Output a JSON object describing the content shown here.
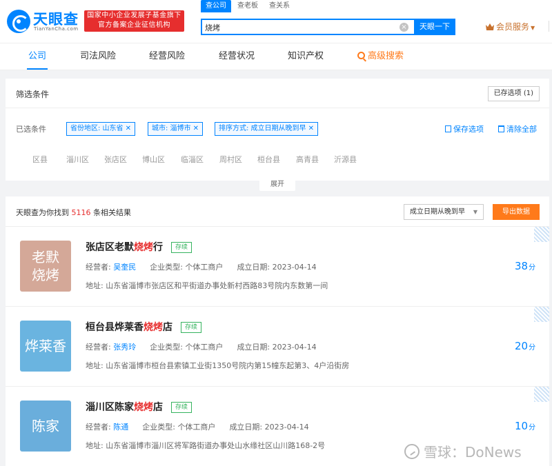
{
  "header": {
    "logo_text": "天眼查",
    "logo_sub": "TianYanCha.com",
    "badge_line1": "国家中小企业发展子基金旗下",
    "badge_line2": "官方备案企业征信机构",
    "search_tabs": [
      "查公司",
      "查老板",
      "查关系"
    ],
    "search_value": "烧烤",
    "search_button": "天眼一下",
    "member": "会员服务"
  },
  "nav": {
    "items": [
      "公司",
      "司法风险",
      "经营风险",
      "经营状况",
      "知识产权"
    ],
    "advanced": "高级搜索"
  },
  "filter": {
    "title": "筛选条件",
    "saved_button": "已存选项 (1)",
    "selected_label": "已选条件",
    "chips": [
      "省份地区: 山东省",
      "城市: 淄博市",
      "排序方式: 成立日期从晚到早"
    ],
    "save_link": "保存选项",
    "clear_link": "清除全部",
    "districts": [
      "区县",
      "淄川区",
      "张店区",
      "博山区",
      "临淄区",
      "周村区",
      "桓台县",
      "高青县",
      "沂源县"
    ],
    "expand": "展开"
  },
  "results": {
    "count_prefix": "天眼查为你找到",
    "count": "5116",
    "count_suffix": "条相关结果",
    "sort": "成立日期从晚到早",
    "export": "导出数据",
    "items": [
      {
        "avatar_text": "老默烧烤",
        "avatar_color": "#d4a898",
        "name_pre": "张店区老默",
        "name_hl": "烧烤",
        "name_post": "行",
        "status": "存续",
        "operator_label": "经营者:",
        "operator": "吴奎民",
        "type_label": "企业类型:",
        "type": "个体工商户",
        "date_label": "成立日期:",
        "date": "2023-04-14",
        "address_label": "地址:",
        "address": "山东省淄博市张店区和平街道办事处新村西路83号院内东数第一间",
        "score": "38",
        "score_unit": "分"
      },
      {
        "avatar_text": "烨莱香",
        "avatar_color": "#6ab4e0",
        "name_pre": "桓台县烨莱香",
        "name_hl": "烧烤",
        "name_post": "店",
        "status": "存续",
        "operator_label": "经营者:",
        "operator": "张秀玲",
        "type_label": "企业类型:",
        "type": "个体工商户",
        "date_label": "成立日期:",
        "date": "2023-04-14",
        "address_label": "地址:",
        "address": "山东省淄博市桓台县索镇工业街1350号院内第15幢东起第3、4户沿街房",
        "score": "20",
        "score_unit": "分"
      },
      {
        "avatar_text": "陈家",
        "avatar_color": "#6aaedc",
        "name_pre": "淄川区陈家",
        "name_hl": "烧烤",
        "name_post": "店",
        "status": "存续",
        "operator_label": "经营者:",
        "operator": "陈通",
        "type_label": "企业类型:",
        "type": "个体工商户",
        "date_label": "成立日期:",
        "date": "2023-04-14",
        "address_label": "地址:",
        "address": "山东省淄博市淄川区将军路街道办事处山水缘社区山川路168-2号",
        "score": "10",
        "score_unit": "分"
      }
    ]
  },
  "watermark": "雪球：DoNews"
}
